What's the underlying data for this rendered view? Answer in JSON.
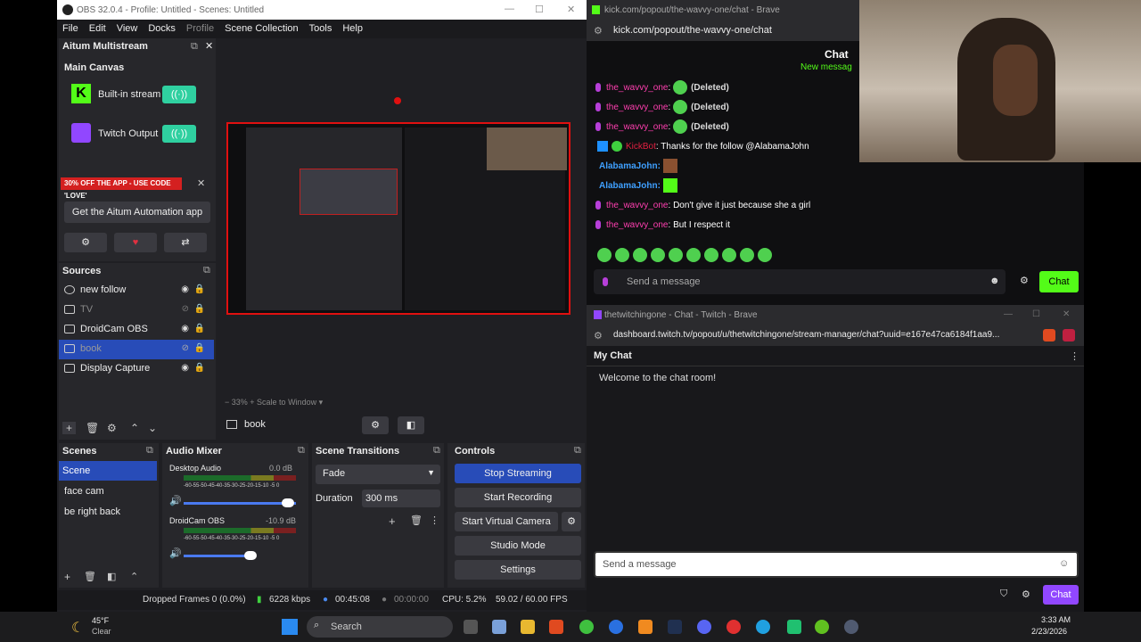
{
  "obs": {
    "title": "OBS 32.0.4 - Profile: Untitled - Scenes: Untitled",
    "menu": [
      "File",
      "Edit",
      "View",
      "Docks",
      "Profile",
      "Scene Collection",
      "Tools",
      "Help"
    ],
    "aitum_title": "Aitum Multistream",
    "main_canvas": "Main Canvas",
    "outputs": [
      {
        "label": "Built-in stream",
        "toggle": "((·))"
      },
      {
        "label": "Twitch Output",
        "toggle": "((·))"
      }
    ],
    "promo": "30% OFF THE APP - USE CODE 'LOVE'",
    "get_app": "Get the Aitum Automation app",
    "sources_title": "Sources",
    "sources": [
      {
        "label": "new follow",
        "selected": false,
        "hidden": false
      },
      {
        "label": "TV",
        "selected": false,
        "hidden": true
      },
      {
        "label": "DroidCam OBS",
        "selected": false,
        "hidden": false
      },
      {
        "label": "book",
        "selected": true,
        "hidden": true
      },
      {
        "label": "Display Capture",
        "selected": false,
        "hidden": false
      }
    ],
    "zoom": "33%",
    "scale_mode": "Scale to Window",
    "selected_source": "book",
    "scenes_title": "Scenes",
    "scenes": [
      "Scene",
      "face cam",
      "be right back"
    ],
    "mixer_title": "Audio Mixer",
    "mixer": [
      {
        "name": "Desktop Audio",
        "db": "0.0 dB"
      },
      {
        "name": "DroidCam OBS",
        "db": "-10.9 dB"
      }
    ],
    "meter_ticks": "-60-55-50-45-40-35-30-25-20-15-10 -5 0",
    "transitions_title": "Scene Transitions",
    "transition": "Fade",
    "duration_label": "Duration",
    "duration": "300 ms",
    "controls_title": "Controls",
    "controls": [
      "Stop Streaming",
      "Start Recording",
      "Start Virtual Camera",
      "Studio Mode",
      "Settings"
    ],
    "status": {
      "dropped": "Dropped Frames 0 (0.0%)",
      "kbps": "6228 kbps",
      "live": "00:45:08",
      "rec": "00:00:00",
      "cpu": "CPU: 5.2%",
      "fps": "59.02 / 60.00 FPS"
    }
  },
  "kick": {
    "tab_title": "kick.com/popout/the-wavvy-one/chat - Brave",
    "url": "kick.com/popout/the-wavvy-one/chat",
    "chat_header": "Chat",
    "new_messages": "New messag",
    "messages": [
      {
        "user": "the_wavvy_one",
        "text": "(Deleted)"
      },
      {
        "user": "the_wavvy_one",
        "text": "(Deleted)"
      },
      {
        "user": "the_wavvy_one",
        "text": "(Deleted)"
      },
      {
        "user": "KickBot",
        "text": "Thanks for the follow @AlabamaJohn"
      },
      {
        "user": "AlabamaJohn:",
        "text": ""
      },
      {
        "user": "AlabamaJohn:",
        "text": ""
      },
      {
        "user": "the_wavvy_one",
        "text": "Don't give it just because she a girl"
      },
      {
        "user": "the_wavvy_one",
        "text": "But I respect it"
      }
    ],
    "placeholder": "Send a message",
    "chat_button": "Chat"
  },
  "twitch": {
    "tab_title": "thetwitchingone - Chat - Twitch - Brave",
    "url": "dashboard.twitch.tv/popout/u/thetwitchingone/stream-manager/chat?uuid=e167e47ca6184f1aa9...",
    "my_chat": "My Chat",
    "welcome": "Welcome to the chat room!",
    "placeholder": "Send a message",
    "chat_button": "Chat"
  },
  "taskbar": {
    "weather_temp": "45°F",
    "weather_desc": "Clear",
    "search": "Search",
    "time": "3:33 AM",
    "date": "2/23/2026"
  },
  "colors": {
    "accent_blue": "#284cb8",
    "kick_green": "#53fc18",
    "twitch_purple": "#9147ff",
    "obs_bg": "#1f1f23"
  }
}
